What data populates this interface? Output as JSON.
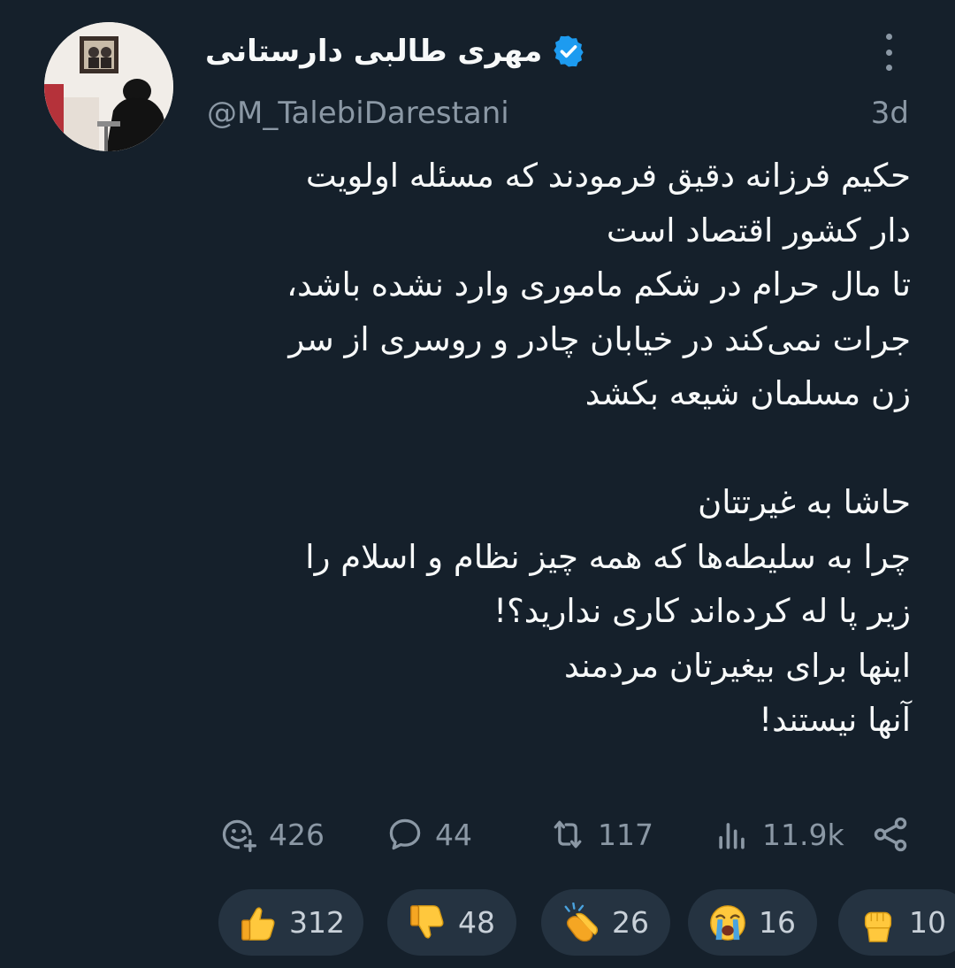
{
  "tweet": {
    "display_name": "مهری طالبی دارستانی",
    "verified": true,
    "handle": "@M_TalebiDarestani",
    "time": "3d",
    "body_lines": [
      "حکیم فرزانه دقیق فرمودند که مسئله اولویت",
      "دار کشور اقتصاد است",
      "تا مال حرام در شکم ماموری وارد نشده باشد،",
      "جرات نمی‌کند در خیابان چادر و روسری از سر",
      "زن مسلمان شیعه بکشد",
      "",
      "حاشا به غیرتتان",
      "چرا به سلیطه‌ها که همه چیز نظام و اسلام را",
      "زیر پا له کرده‌اند کاری ندارید؟!",
      "اینها برای بیغیرتان مردمند",
      "آنها نیستند!"
    ]
  },
  "actions": {
    "react_count": "426",
    "reply_count": "44",
    "retweet_count": "117",
    "views_count": "11.9k"
  },
  "reactions": [
    {
      "emoji": "thumbs-up",
      "count": "312"
    },
    {
      "emoji": "thumbs-down",
      "count": "48"
    },
    {
      "emoji": "clapping-hands",
      "count": "26"
    },
    {
      "emoji": "loudly-crying-face",
      "count": "16"
    },
    {
      "emoji": "raised-fist",
      "count": "10"
    }
  ],
  "colors": {
    "background": "#15202b",
    "primary_text": "#f7f9f9",
    "secondary_text": "#8b98a5",
    "verified_blue": "#1d9bf0",
    "pill_background": "#253341"
  }
}
